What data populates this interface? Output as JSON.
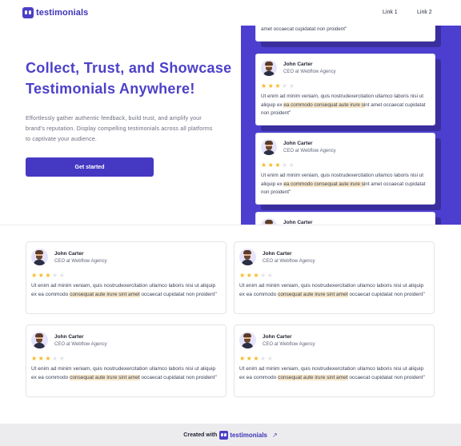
{
  "nav": {
    "logo_text": "testimonials",
    "links": [
      "Link 1",
      "Link 2"
    ]
  },
  "hero": {
    "title": "Collect, Trust, and Showcase Testimonials Anywhere!",
    "description": "Effortlessly gather authentic feedback, build trust, and amplify your brand's reputation. Display compelling testimonials across all platforms to captivate your audience.",
    "cta_label": "Get started"
  },
  "testimonial": {
    "name": "John Carter",
    "role": "CEO at Webflow Agency",
    "rating": 3,
    "max_rating": 5,
    "text_before": "Ut enim ad minim veniam, quis nostrudexercitation ullamco laboris nisi ut aliquip ex ",
    "text_hero_highlight": "ea commodo consequat aute irure si",
    "text_hero_after": "nt amet occaecat cupidatat non proident\"",
    "text_grid_before": "Ut enim ad minim veniam, quis nostrudexercitation ullamco laboris nisi ut aliquip ex ea commodo ",
    "text_grid_highlight": "consequat aute irure sint amet",
    "text_grid_after": " occaecat cupidatat non proident\"",
    "partial_top_text": "amet occaecat cupidatat non proident\""
  },
  "footer": {
    "label": "Created with",
    "logo_text": "testimonials",
    "arrow": "↗"
  },
  "colors": {
    "brand": "#4b3fc4",
    "panel": "#4c3fd0",
    "star": "#f5b921",
    "highlight": "#f7e7c8"
  }
}
